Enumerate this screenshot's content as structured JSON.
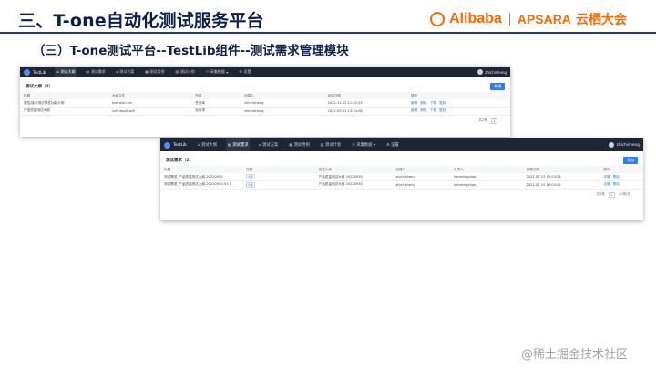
{
  "slide": {
    "title": "三、T-one自动化测试服务平台",
    "subtitle": "（三）T-one测试平台--TestLib组件--测试需求管理模块",
    "logo_brand": "Alibaba",
    "logo_product": "APSARA",
    "logo_event": "云栖大会",
    "watermark": "@稀土掘金技术社区"
  },
  "colors": {
    "accent": "#2f7cf6",
    "navbar": "#1f2533",
    "brand": "#ff6a00",
    "title": "#0b1f4a"
  },
  "window1": {
    "brand": "TestLib",
    "nav": [
      {
        "icon": "⌂",
        "label": "测试大纲",
        "active": true
      },
      {
        "icon": "▤",
        "label": "测试需求"
      },
      {
        "icon": "▸",
        "label": "测试方案"
      },
      {
        "icon": "▦",
        "label": "测试用例"
      },
      {
        "icon": "▧",
        "label": "测试计划"
      },
      {
        "icon": "⚇",
        "label": "采集数据",
        "dropdown": "▾"
      },
      {
        "icon": "⚙",
        "label": "设置"
      }
    ],
    "user": "zhichisheng",
    "panel_title": "测试大纲（2）",
    "add_label": "新增",
    "columns": [
      "标题",
      "大纲文件",
      "所属",
      "创建人",
      "创建日期",
      "操作"
    ],
    "rows": [
      [
        "属性/版本测试特性功能示例",
        "test-plan.txt",
        "任务库",
        "zhichisheng",
        "2022-11-02 11:32:33"
      ],
      [
        "产品质量测试大纲",
        "xxfl-result.pdf",
        "没有项",
        "zhichisheng",
        "2022-09-01 13:24:08"
      ]
    ],
    "ops": [
      "编辑",
      "删除",
      "下载",
      "复制"
    ],
    "pager_total": "共2条",
    "pager_page": "1"
  },
  "window2": {
    "brand": "TestLib",
    "nav": [
      {
        "icon": "⌂",
        "label": "测试大纲"
      },
      {
        "icon": "▤",
        "label": "测试需求",
        "active": true
      },
      {
        "icon": "▸",
        "label": "测试方案"
      },
      {
        "icon": "▦",
        "label": "测试用例"
      },
      {
        "icon": "▧",
        "label": "测试计划"
      },
      {
        "icon": "⚇",
        "label": "采集数据",
        "dropdown": "▾"
      },
      {
        "icon": "⚙",
        "label": "设置"
      }
    ],
    "user": "zhichisheng",
    "panel_title": "测试需求（2）",
    "add_label": "添加",
    "columns": [
      "标题",
      "所属",
      "测试大纲",
      "创建人",
      "负责人",
      "创建日期",
      "操作"
    ],
    "rows": [
      [
        "测试需求_产品质量测试大纲-20220930",
        "所属",
        "产品质量测试大纲 20220930",
        "zhichisheng",
        "haomingchao",
        "2022-07-15 15:03:24"
      ],
      [
        "测试需求_产品质量测试大纲-20220930-V1.1",
        "所属",
        "产品质量测试大纲 20220930",
        "zhichisheng",
        "haomingchao",
        "2022-07-15 16:00:02"
      ]
    ],
    "ops": [
      "详情",
      "删除"
    ],
    "pager_total": "共2条",
    "pager_page": "1",
    "pager_size": "10条/页"
  }
}
